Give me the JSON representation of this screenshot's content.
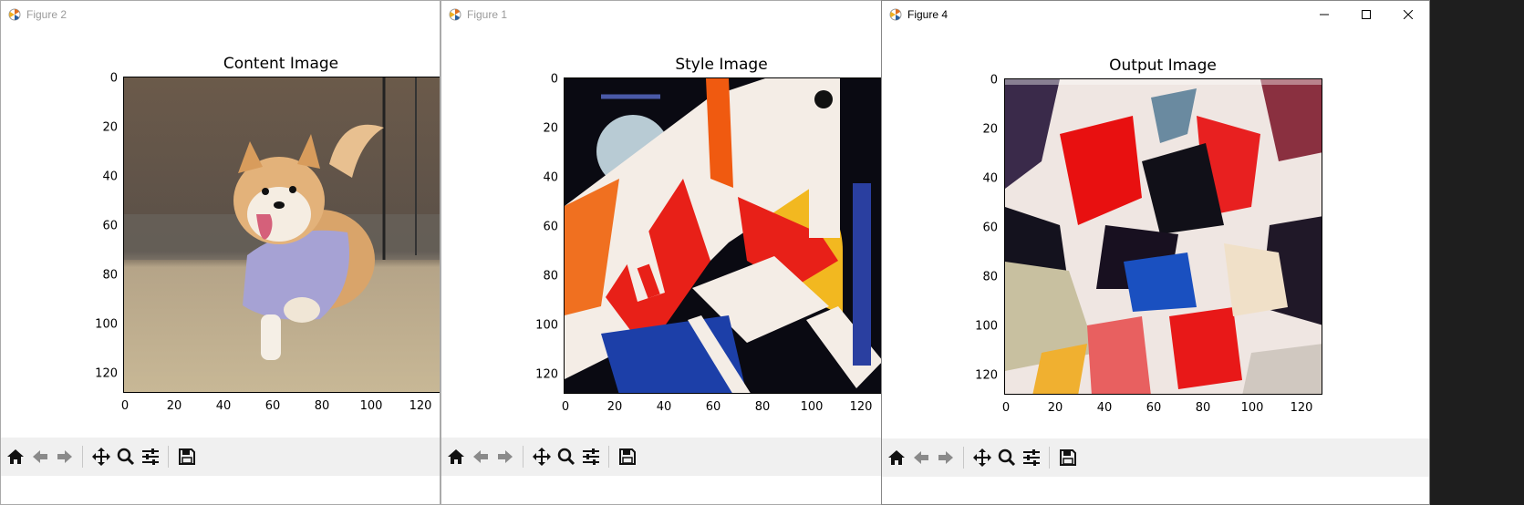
{
  "windows": [
    {
      "title": "Figure 2",
      "figure_title": "Content Image",
      "y_ticks": [
        "0",
        "20",
        "40",
        "60",
        "80",
        "100",
        "120"
      ],
      "x_ticks": [
        "0",
        "20",
        "40",
        "60",
        "80",
        "100",
        "120"
      ],
      "image_desc": "corgi"
    },
    {
      "title": "Figure 1",
      "figure_title": "Style Image",
      "y_ticks": [
        "0",
        "20",
        "40",
        "60",
        "80",
        "100",
        "120"
      ],
      "x_ticks": [
        "0",
        "20",
        "40",
        "60",
        "80",
        "100",
        "120"
      ],
      "image_desc": "abstract"
    },
    {
      "title": "Figure 4",
      "figure_title": "Output Image",
      "y_ticks": [
        "0",
        "20",
        "40",
        "60",
        "80",
        "100",
        "120"
      ],
      "x_ticks": [
        "0",
        "20",
        "40",
        "60",
        "80",
        "100",
        "120"
      ],
      "image_desc": "stylized"
    }
  ],
  "toolbar_icons": [
    "home-icon",
    "back-arrow-icon",
    "forward-arrow-icon",
    "pan-icon",
    "zoom-icon",
    "configure-subplots-icon",
    "save-icon"
  ],
  "colors": {
    "toolbar_bg": "#f0f0f0",
    "window_bg": "#ffffff"
  }
}
